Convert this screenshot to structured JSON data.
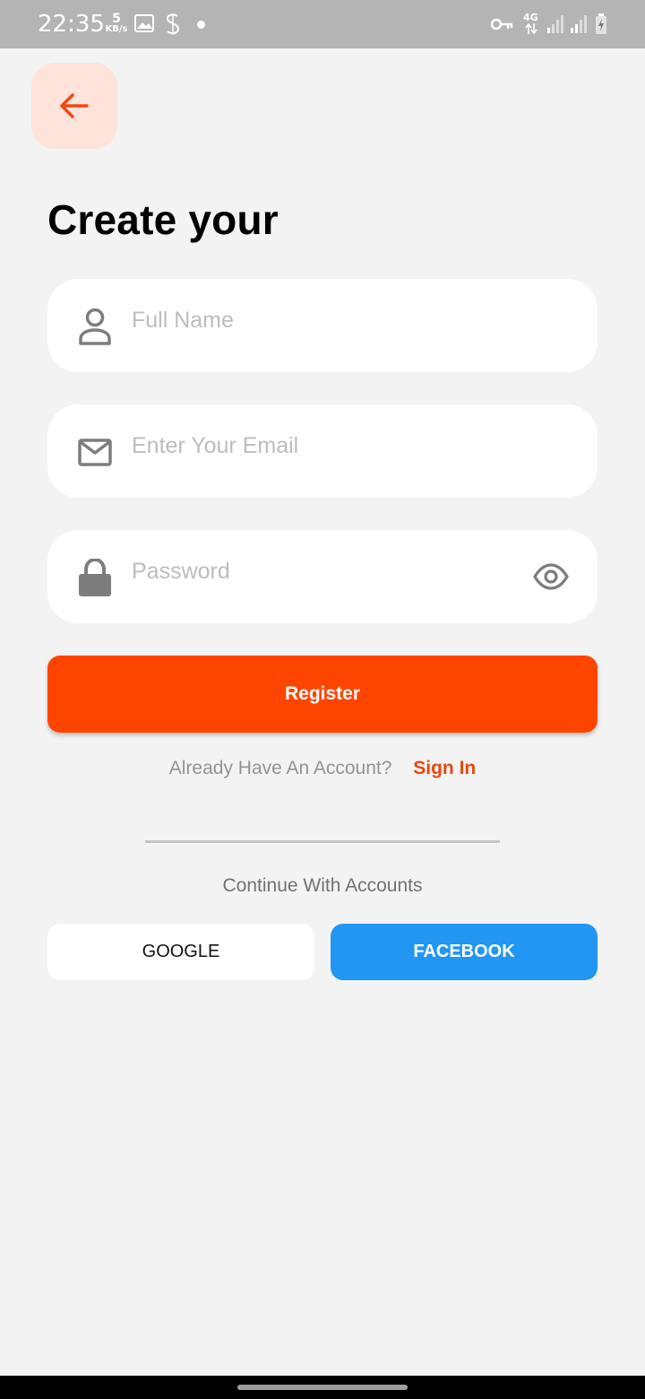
{
  "status_bar": {
    "time": "22:35",
    "speed_value": "5",
    "speed_unit": "KB/s",
    "network": "4G"
  },
  "title": "Create your",
  "form": {
    "full_name_placeholder": "Full Name",
    "email_placeholder": "Enter Your Email",
    "password_placeholder": "Password",
    "full_name_value": "",
    "email_value": "",
    "password_value": ""
  },
  "register_label": "Register",
  "account_prompt": "Already Have An Account?",
  "sign_in_label": "Sign In",
  "continue_text": "Continue With Accounts",
  "social": {
    "google_label": "GOOGLE",
    "facebook_label": "FACEBOOK"
  },
  "colors": {
    "accent": "#fe4500",
    "back_button_bg": "#fde3da",
    "facebook_blue": "#2196f3",
    "background": "#f3f3f3"
  },
  "icons": [
    "arrow-left-icon",
    "person-icon",
    "mail-icon",
    "lock-icon",
    "eye-icon"
  ]
}
